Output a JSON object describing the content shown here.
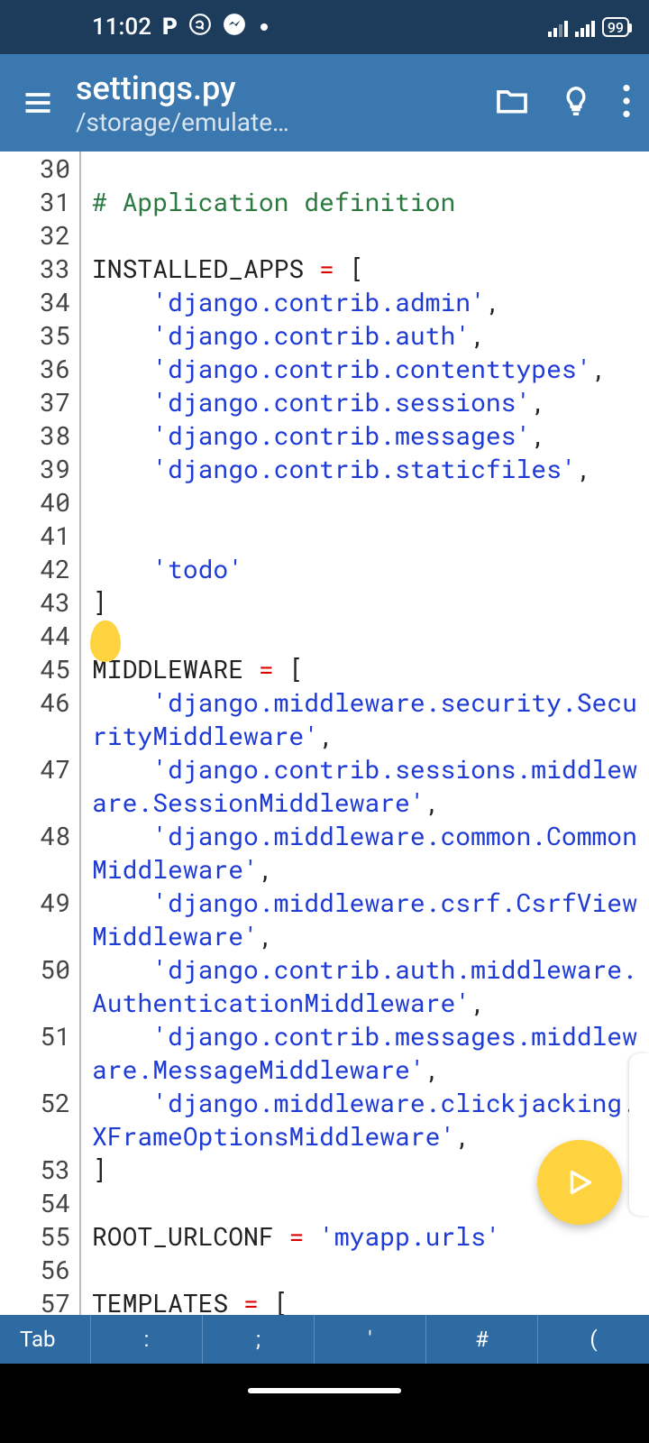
{
  "status": {
    "time": "11:02",
    "battery": "99"
  },
  "appbar": {
    "title": "settings.py",
    "subtitle": "/storage/emulate…"
  },
  "keys": {
    "tab": "Tab",
    "k1": ":",
    "k2": ";",
    "k3": "'",
    "k4": "#",
    "k5": "("
  },
  "lines": [
    {
      "n": "30",
      "segs": []
    },
    {
      "n": "31",
      "segs": [
        {
          "t": "# Application definition",
          "c": "c-comment"
        }
      ]
    },
    {
      "n": "32",
      "segs": []
    },
    {
      "n": "33",
      "segs": [
        {
          "t": "INSTALLED_APPS ",
          "c": "c-ident"
        },
        {
          "t": "=",
          "c": "c-op"
        },
        {
          "t": " [",
          "c": "c-ident"
        }
      ]
    },
    {
      "n": "34",
      "segs": [
        {
          "t": "    ",
          "c": ""
        },
        {
          "t": "'django.contrib.admin'",
          "c": "c-string"
        },
        {
          "t": ",",
          "c": "c-ident"
        }
      ]
    },
    {
      "n": "35",
      "segs": [
        {
          "t": "    ",
          "c": ""
        },
        {
          "t": "'django.contrib.auth'",
          "c": "c-string"
        },
        {
          "t": ",",
          "c": "c-ident"
        }
      ]
    },
    {
      "n": "36",
      "segs": [
        {
          "t": "    ",
          "c": ""
        },
        {
          "t": "'django.contrib.contenttypes'",
          "c": "c-string"
        },
        {
          "t": ",",
          "c": "c-ident"
        }
      ]
    },
    {
      "n": "37",
      "segs": [
        {
          "t": "    ",
          "c": ""
        },
        {
          "t": "'django.contrib.sessions'",
          "c": "c-string"
        },
        {
          "t": ",",
          "c": "c-ident"
        }
      ]
    },
    {
      "n": "38",
      "segs": [
        {
          "t": "    ",
          "c": ""
        },
        {
          "t": "'django.contrib.messages'",
          "c": "c-string"
        },
        {
          "t": ",",
          "c": "c-ident"
        }
      ]
    },
    {
      "n": "39",
      "segs": [
        {
          "t": "    ",
          "c": ""
        },
        {
          "t": "'django.contrib.staticfiles'",
          "c": "c-string"
        },
        {
          "t": ",",
          "c": "c-ident"
        }
      ]
    },
    {
      "n": "40",
      "segs": []
    },
    {
      "n": "41",
      "segs": []
    },
    {
      "n": "42",
      "segs": [
        {
          "t": "    ",
          "c": ""
        },
        {
          "t": "'todo'",
          "c": "c-string"
        }
      ]
    },
    {
      "n": "43",
      "segs": [
        {
          "t": "]",
          "c": "c-ident"
        }
      ]
    },
    {
      "n": "44",
      "segs": []
    },
    {
      "n": "45",
      "segs": [
        {
          "t": "MIDDLEWARE ",
          "c": "c-ident"
        },
        {
          "t": "=",
          "c": "c-op"
        },
        {
          "t": " [",
          "c": "c-ident"
        }
      ]
    },
    {
      "n": "46",
      "segs": [
        {
          "t": "    ",
          "c": ""
        },
        {
          "t": "'django.middleware.security.SecurityMiddleware'",
          "c": "c-string"
        },
        {
          "t": ",",
          "c": "c-ident"
        }
      ]
    },
    {
      "n": "47",
      "segs": [
        {
          "t": "    ",
          "c": ""
        },
        {
          "t": "'django.contrib.sessions.middleware.SessionMiddleware'",
          "c": "c-string"
        },
        {
          "t": ",",
          "c": "c-ident"
        }
      ]
    },
    {
      "n": "48",
      "segs": [
        {
          "t": "    ",
          "c": ""
        },
        {
          "t": "'django.middleware.common.CommonMiddleware'",
          "c": "c-string"
        },
        {
          "t": ",",
          "c": "c-ident"
        }
      ]
    },
    {
      "n": "49",
      "segs": [
        {
          "t": "    ",
          "c": ""
        },
        {
          "t": "'django.middleware.csrf.CsrfViewMiddleware'",
          "c": "c-string"
        },
        {
          "t": ",",
          "c": "c-ident"
        }
      ]
    },
    {
      "n": "50",
      "segs": [
        {
          "t": "    ",
          "c": ""
        },
        {
          "t": "'django.contrib.auth.middleware.AuthenticationMiddleware'",
          "c": "c-string"
        },
        {
          "t": ",",
          "c": "c-ident"
        }
      ]
    },
    {
      "n": "51",
      "segs": [
        {
          "t": "    ",
          "c": ""
        },
        {
          "t": "'django.contrib.messages.middleware.MessageMiddleware'",
          "c": "c-string"
        },
        {
          "t": ",",
          "c": "c-ident"
        }
      ]
    },
    {
      "n": "52",
      "segs": [
        {
          "t": "    ",
          "c": ""
        },
        {
          "t": "'django.middleware.clickjacking.XFrameOptionsMiddleware'",
          "c": "c-string"
        },
        {
          "t": ",",
          "c": "c-ident"
        }
      ]
    },
    {
      "n": "53",
      "segs": [
        {
          "t": "]",
          "c": "c-ident"
        }
      ]
    },
    {
      "n": "54",
      "segs": []
    },
    {
      "n": "55",
      "segs": [
        {
          "t": "ROOT_URLCONF ",
          "c": "c-ident"
        },
        {
          "t": "=",
          "c": "c-op"
        },
        {
          "t": " ",
          "c": ""
        },
        {
          "t": "'myapp.urls'",
          "c": "c-string"
        }
      ]
    },
    {
      "n": "56",
      "segs": []
    },
    {
      "n": "57",
      "segs": [
        {
          "t": "TEMPLATES ",
          "c": "c-ident"
        },
        {
          "t": "=",
          "c": "c-op"
        },
        {
          "t": " [",
          "c": "c-ident"
        }
      ]
    }
  ]
}
